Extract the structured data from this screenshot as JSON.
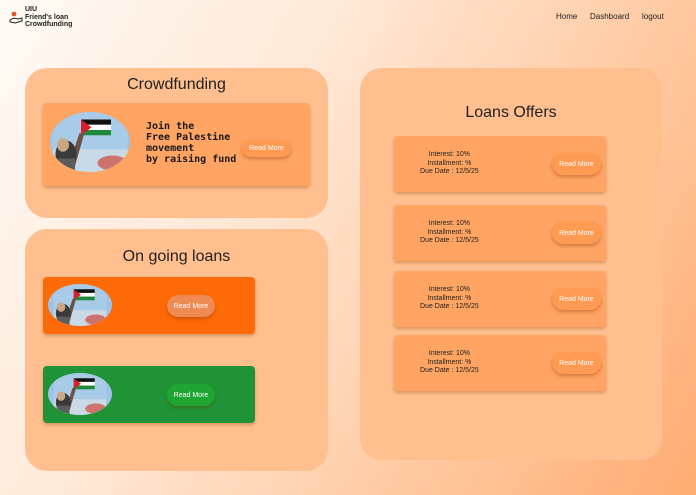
{
  "header": {
    "brand_lines": [
      "UIU",
      "Friend's loan",
      "Crowdfunding"
    ],
    "nav": {
      "home": "Home",
      "dashboard": "Dashboard",
      "logout": "logout"
    }
  },
  "crowdfunding": {
    "title": "Crowdfunding",
    "headline_lines": [
      "Join the",
      "Free Palestine",
      "movement",
      "by raising fund"
    ],
    "button_label": "Read More"
  },
  "ongoing": {
    "title": "On going loans",
    "loans": [
      {
        "button_label": "Read More",
        "color": "#ff6a08"
      },
      {
        "button_label": "Read More",
        "color": "#1f9335"
      }
    ]
  },
  "offers": {
    "title": "Loans Offers",
    "items": [
      {
        "interest": "Interest: 10%",
        "installment": "Installment: %",
        "due": "Due Date : 12/5/25",
        "button_label": "Read More"
      },
      {
        "interest": "Interest: 10%",
        "installment": "Installment: %",
        "due": "Due Date : 12/5/25",
        "button_label": "Read More"
      },
      {
        "interest": "Interest: 10%",
        "installment": "Installment: %",
        "due": "Due Date : 12/5/25",
        "button_label": "Read More"
      },
      {
        "interest": "Interest: 10%",
        "installment": "Installment: %",
        "due": "Due Date : 12/5/25",
        "button_label": "Read More"
      }
    ]
  },
  "colors": {
    "panel": "#ffbf8e",
    "card": "#ffa462",
    "button": "#ff9a52"
  },
  "icons": [
    "logo-hand-icon",
    "flag-photo-image"
  ]
}
